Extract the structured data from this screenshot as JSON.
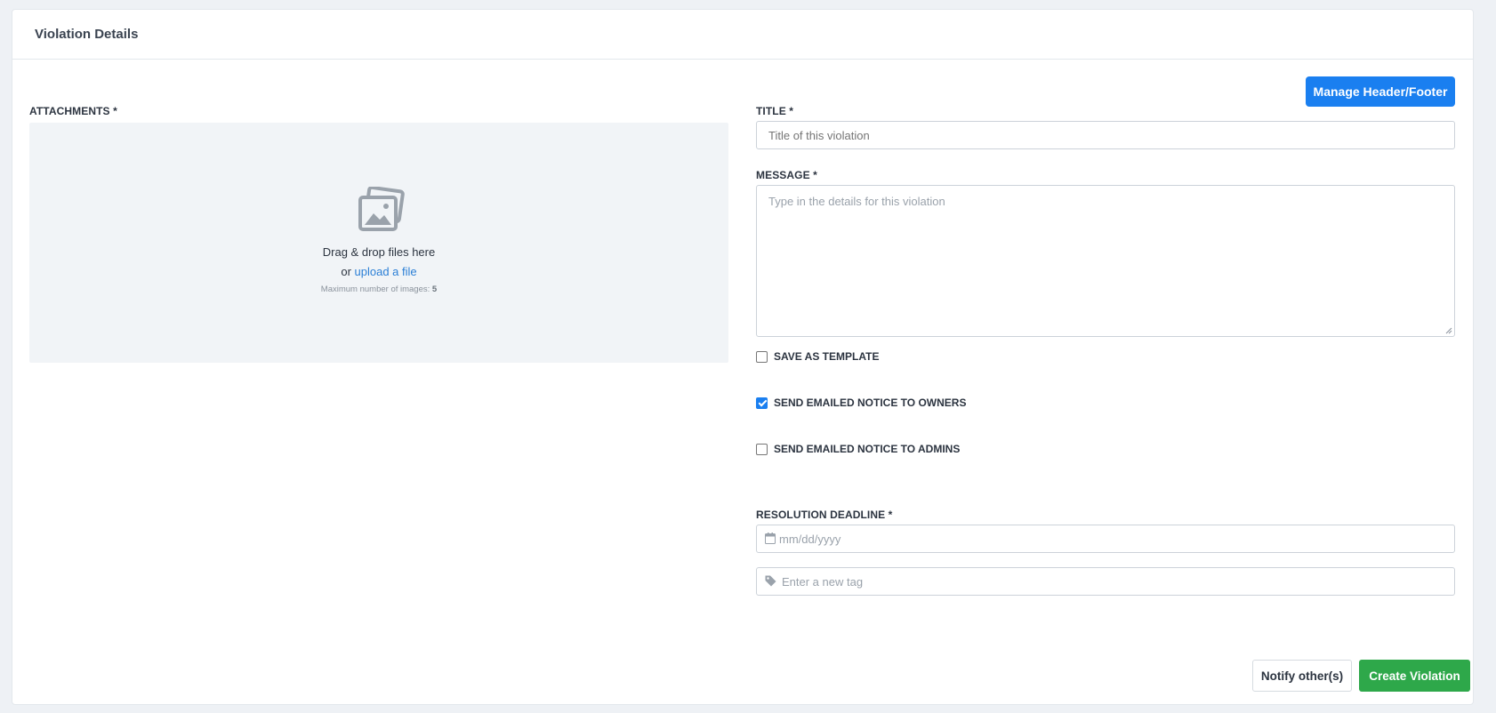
{
  "header": {
    "title": "Violation Details"
  },
  "toolbar": {
    "manage_label": "Manage Header/Footer"
  },
  "attachments": {
    "label": "ATTACHMENTS *",
    "drag_text": "Drag & drop files here",
    "or_text": "or",
    "upload_link": "upload a file",
    "max_text": "Maximum number of images:",
    "max_value": "5"
  },
  "title_field": {
    "label": "TITLE *",
    "placeholder": "Title of this violation",
    "value": ""
  },
  "message_field": {
    "label": "MESSAGE *",
    "placeholder": "Type in the details for this violation",
    "value": ""
  },
  "checkboxes": [
    {
      "label": "SAVE AS TEMPLATE",
      "checked": false
    },
    {
      "label": "SEND EMAILED NOTICE TO OWNERS",
      "checked": true
    },
    {
      "label": "SEND EMAILED NOTICE TO ADMINS",
      "checked": false
    }
  ],
  "deadline_field": {
    "label": "RESOLUTION DEADLINE *",
    "placeholder": "mm/dd/yyyy",
    "icon": "calendar-icon"
  },
  "tag_field": {
    "placeholder": "Enter a new tag",
    "icon": "tag-icon"
  },
  "footer": {
    "notify_label": "Notify other(s)",
    "create_label": "Create Violation"
  },
  "colors": {
    "primary": "#1a7ff0",
    "success": "#2ea84a",
    "dropzone_bg": "#f1f4f7"
  }
}
